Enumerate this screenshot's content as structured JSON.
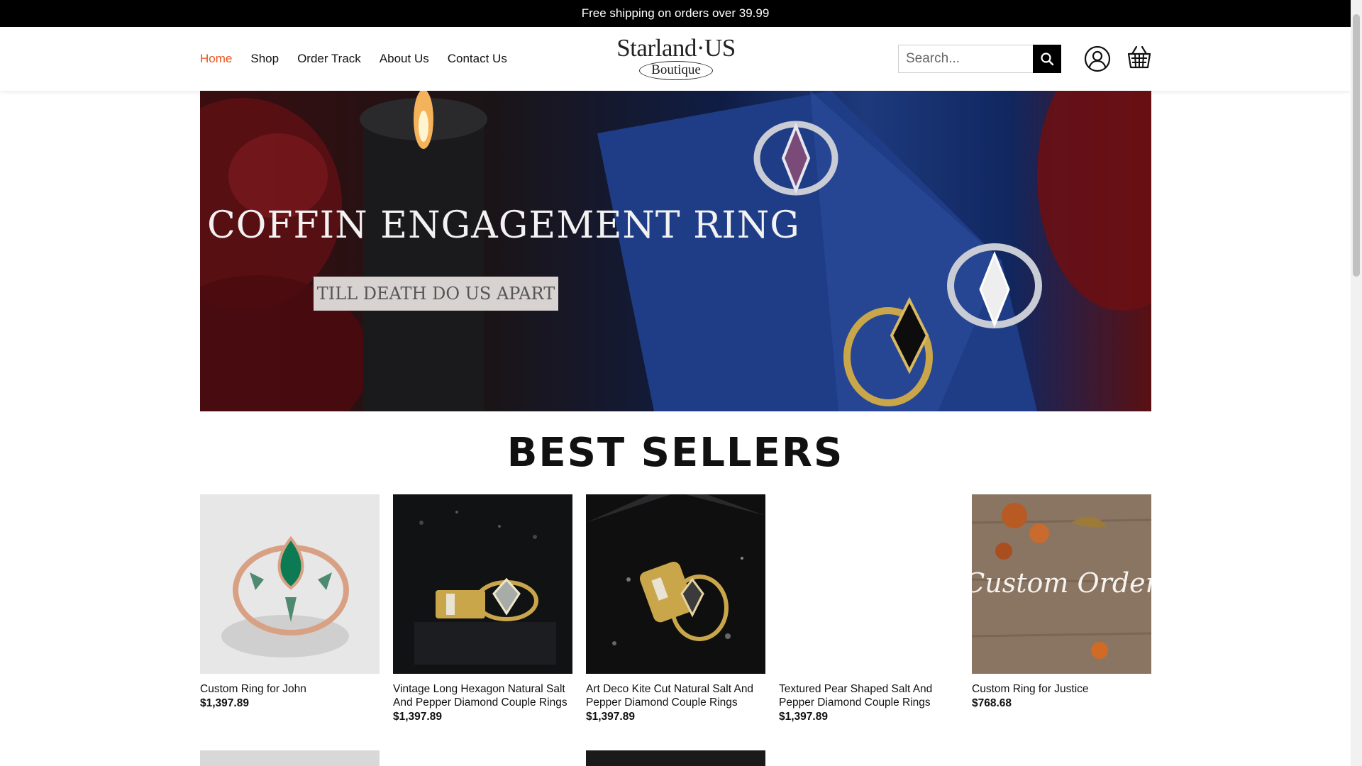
{
  "topbar": {
    "message": "Free shipping on orders over 39.99"
  },
  "nav": [
    {
      "label": "Home",
      "active": true
    },
    {
      "label": "Shop"
    },
    {
      "label": "Order Track"
    },
    {
      "label": "About Us"
    },
    {
      "label": "Contact Us"
    }
  ],
  "logo": {
    "main": "Starland·US",
    "sub": "Boutique"
  },
  "search": {
    "placeholder": "Search..."
  },
  "icons": {
    "search": "search-icon",
    "account": "user-icon",
    "cart": "cart-icon"
  },
  "hero": {
    "title": "COFFIN ENGAGEMENT RING",
    "tagline": "TILL DEATH DO US APART"
  },
  "best_sellers": {
    "title": "BEST SELLERS",
    "products": [
      {
        "name": "Custom Ring for John",
        "price": "$1,397.89"
      },
      {
        "name": "Vintage Long Hexagon Natural Salt And Pepper Diamond Couple Rings",
        "price": "$1,397.89"
      },
      {
        "name": "Art Deco Kite Cut Natural Salt And Pepper Diamond Couple Rings",
        "price": "$1,397.89"
      },
      {
        "name": "Textured Pear Shaped Salt And Pepper Diamond Couple Rings",
        "price": "$1,397.89"
      },
      {
        "name": "Custom Ring for Justice",
        "price": "$768.68",
        "image_text": "Custom Order"
      }
    ]
  },
  "colors": {
    "accent": "#e8541d",
    "topbar_bg": "#000000"
  }
}
